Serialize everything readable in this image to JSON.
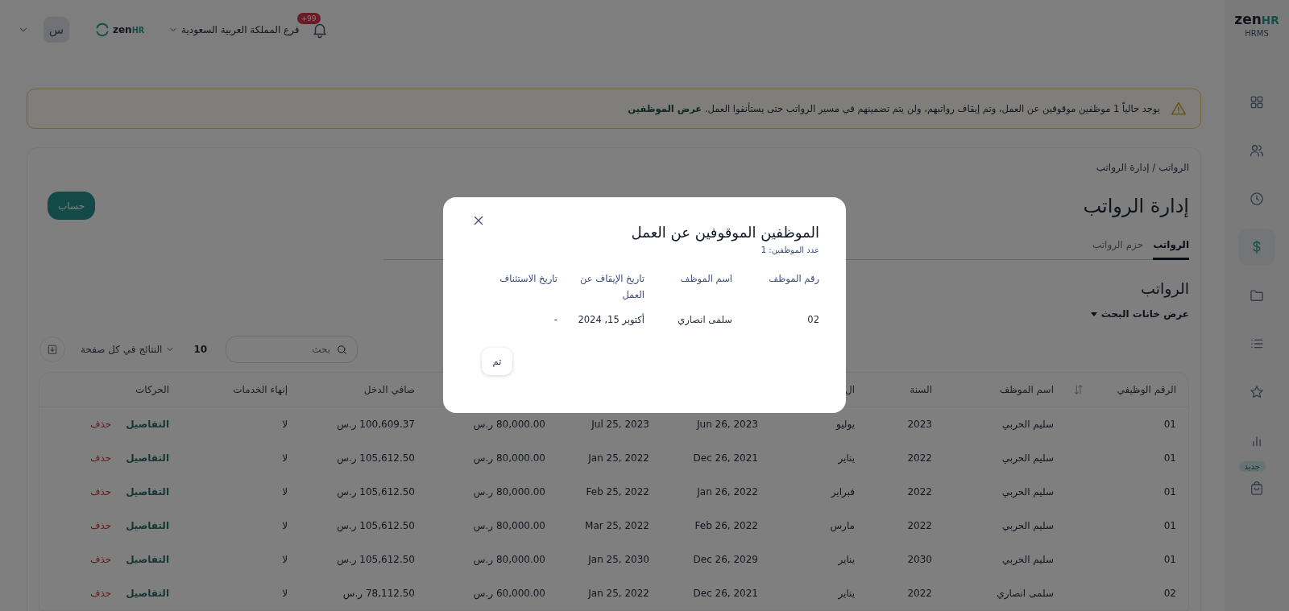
{
  "sidebar": {
    "logo": {
      "name": "zen",
      "accent": "HR",
      "product": "HRMS"
    },
    "items": [
      {
        "selected": false
      },
      {
        "selected": false
      },
      {
        "selected": false
      },
      {
        "selected": true
      },
      {
        "selected": false
      },
      {
        "selected": false
      },
      {
        "selected": false
      },
      {
        "selected": false
      },
      {
        "selected": false,
        "badge": "جديد"
      }
    ]
  },
  "header": {
    "notifications": "+99",
    "branch": "فرع المملكة العربية السعودية",
    "logo": {
      "name": "zen",
      "accent": "HR"
    },
    "avatar": "س"
  },
  "banner": {
    "message": "يوجد حالياً 1 موظفين موقوفين عن العمل، وتم إيقاف رواتبهم، ولن يتم تضمينهم في مسير الرواتب حتى يستأنفوا العمل.",
    "link": "عرض الموظفين"
  },
  "breadcrumb": "الرواتب / إدارة الرواتب",
  "page_title": "إدارة الرواتب",
  "primary_button": "حساب",
  "tabs": [
    {
      "label": "الرواتب",
      "selected": true
    },
    {
      "label": "حزم الرواتب",
      "selected": false
    }
  ],
  "section_title": "الرواتب",
  "search_toggle": "عرض خانات البحث",
  "toolbar": {
    "search_placeholder": "بحث",
    "page_size": "10",
    "page_size_label": "النتائج في كل صفحة"
  },
  "table": {
    "columns": [
      {
        "label": "الرقم الوظيفي",
        "sort_icon": true
      },
      {
        "label": "اسم الموظف"
      },
      {
        "label": "السنة"
      },
      {
        "label": "ال"
      },
      {},
      {},
      {},
      {
        "label": "صافي الدخل"
      },
      {
        "label": "إنهاء الخدمات"
      },
      {
        "label": "الحركات"
      }
    ],
    "rows": [
      {
        "cells": [
          "01",
          "سليم الحربي",
          "2023",
          "يوليو",
          "Jun 26, 2023",
          "Jul 25, 2023",
          "80,000.00 ر.س",
          "100,609.37 ر.س",
          "لا"
        ],
        "actions": [
          {
            "label": "التفاصيل",
            "kind": "details"
          },
          {
            "label": "حذف",
            "kind": "delete"
          }
        ]
      },
      {
        "cells": [
          "01",
          "سليم الحربي",
          "2022",
          "يناير",
          "Dec 26, 2021",
          "Jan 25, 2022",
          "80,000.00 ر.س",
          "105,612.50 ر.س",
          "لا"
        ],
        "actions": [
          {
            "label": "التفاصيل",
            "kind": "details"
          },
          {
            "label": "حذف",
            "kind": "delete"
          }
        ]
      },
      {
        "cells": [
          "01",
          "سليم الحربي",
          "2022",
          "فبراير",
          "Jan 26, 2022",
          "Feb 25, 2022",
          "80,000.00 ر.س",
          "105,612.50 ر.س",
          "لا"
        ],
        "actions": [
          {
            "label": "التفاصيل",
            "kind": "details"
          },
          {
            "label": "حذف",
            "kind": "delete"
          }
        ]
      },
      {
        "cells": [
          "01",
          "سليم الحربي",
          "2022",
          "مارس",
          "Feb 26, 2022",
          "Mar 25, 2022",
          "80,000.00 ر.س",
          "105,612.50 ر.س",
          "لا"
        ],
        "actions": [
          {
            "label": "التفاصيل",
            "kind": "details"
          },
          {
            "label": "حذف",
            "kind": "delete"
          }
        ]
      },
      {
        "cells": [
          "01",
          "سليم الحربي",
          "2030",
          "يناير",
          "Dec 26, 2029",
          "Jan 25, 2030",
          "80,000.00 ر.س",
          "105,612.50 ر.س",
          "لا"
        ],
        "actions": [
          {
            "label": "التفاصيل",
            "kind": "details"
          },
          {
            "label": "حذف",
            "kind": "delete"
          }
        ]
      },
      {
        "cells": [
          "02",
          "سلمى انصاري",
          "2022",
          "يناير",
          "Dec 26, 2021",
          "Jan 25, 2022",
          "60,000.00 ر.س",
          "78,112.50 ر.س",
          "لا"
        ],
        "actions": [
          {
            "label": "التفاصيل",
            "kind": "details"
          },
          {
            "label": "حذف",
            "kind": "delete"
          }
        ]
      }
    ]
  },
  "dialog": {
    "title": "الموظفين الموقوفين عن العمل",
    "count": "عدد الموظفين: 1",
    "columns": [
      "رقم الموظف",
      "اسم الموظف",
      "تاريخ الإيقاف عن العمل",
      "تاريخ الاستئناف"
    ],
    "rows": [
      [
        "02",
        "سلمى انصاري",
        "أكتوبر 15, 2024",
        "-"
      ]
    ],
    "button": "تم"
  }
}
